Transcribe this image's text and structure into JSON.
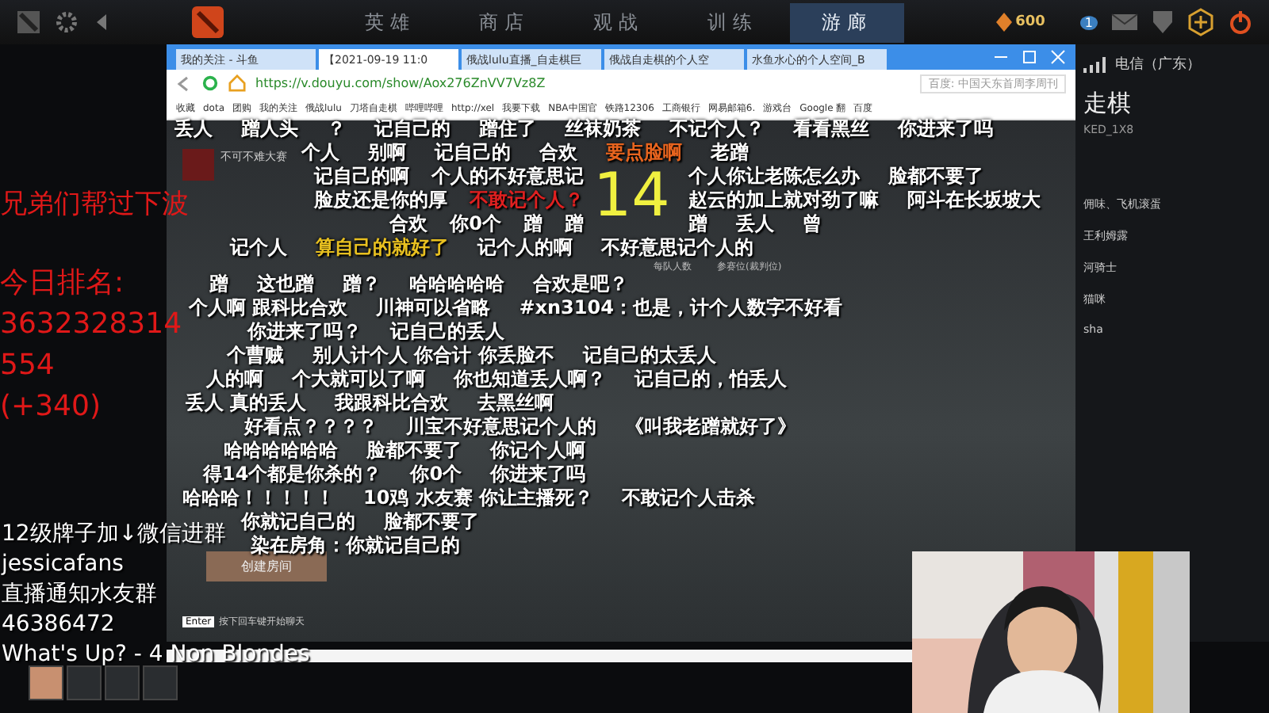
{
  "game_nav": {
    "tabs": [
      {
        "label": "英雄",
        "selected": false
      },
      {
        "label": "商店",
        "selected": false
      },
      {
        "label": "观战",
        "selected": false
      },
      {
        "label": "训练",
        "selected": false
      },
      {
        "label": "游廊",
        "selected": true
      }
    ],
    "currency": "600",
    "mail_count": "1",
    "network": "电信（广东）"
  },
  "browser": {
    "tabs": [
      {
        "title": "我的关注 - 斗鱼",
        "selected": false
      },
      {
        "title": "【2021-09-19 11:0",
        "selected": true
      },
      {
        "title": "俄战lulu直播_自走棋巨",
        "selected": false
      },
      {
        "title": "俄战自走棋的个人空",
        "selected": false
      },
      {
        "title": "水鱼水心的个人空间_B",
        "selected": false
      }
    ],
    "url": "https://v.douyu.com/show/Aox276ZnVV7Vz8Z",
    "search_placeholder": "百度: 中国天东首周李周刊",
    "bookmarks": [
      "收藏",
      "dota",
      "团购",
      "我的关注",
      "俄战lulu",
      "刀塔自走棋",
      "哔哩哔哩",
      "http://xel",
      "我要下载",
      "NBA中国官",
      "铁路12306",
      "工商银行",
      "网易邮箱6.",
      "游戏台",
      "Google 翻",
      "百度"
    ]
  },
  "stream": {
    "room_label": "不可不难大赛",
    "counter": "14",
    "table_headers": [
      "每队人数",
      "参赛位(裁判位)"
    ],
    "create_button": "创建房间",
    "enter_key": "Enter",
    "enter_hint": "按下回车键开始聊天",
    "danmaku": [
      [
        {
          "text": "丢人",
          "color": "#ffffff"
        },
        {
          "text": "蹭人头",
          "color": "#ffffff"
        },
        {
          "text": "？",
          "color": "#ffffff"
        },
        {
          "text": "记自己的",
          "color": "#ffffff"
        },
        {
          "text": "蹭住了",
          "color": "#ffffff"
        },
        {
          "text": "丝袜奶茶",
          "color": "#ffffff"
        },
        {
          "text": "不记个人？",
          "color": "#ffffff"
        },
        {
          "text": "看看黑丝",
          "color": "#ffffff"
        },
        {
          "text": "你进来了吗",
          "color": "#ffffff"
        }
      ],
      [
        {
          "text": "个人",
          "color": "#ffffff"
        },
        {
          "text": "别啊",
          "color": "#ffffff"
        },
        {
          "text": "记自己的",
          "color": "#ffffff"
        },
        {
          "text": "合欢",
          "color": "#ffffff"
        },
        {
          "text": "要点脸啊",
          "color": "#e8641e"
        },
        {
          "text": "老蹭",
          "color": "#ffffff"
        }
      ],
      [
        {
          "text": "记自己的啊",
          "color": "#ffffff"
        },
        {
          "text": "个人的不好意思记",
          "color": "#ffffff"
        },
        {
          "text": "个人你让老陈怎么办",
          "color": "#ffffff"
        },
        {
          "text": "脸都不要了",
          "color": "#ffffff"
        }
      ],
      [
        {
          "text": "脸皮还是你的厚",
          "color": "#ffffff"
        },
        {
          "text": "不敢记个人？",
          "color": "#e02020"
        },
        {
          "text": "赵云的加上就对劲了嘛",
          "color": "#ffffff"
        },
        {
          "text": "阿斗在长坂坡大",
          "color": "#ffffff"
        }
      ],
      [
        {
          "text": "合欢",
          "color": "#ffffff"
        },
        {
          "text": "你0个",
          "color": "#ffffff"
        },
        {
          "text": "蹭",
          "color": "#ffffff"
        },
        {
          "text": "蹭",
          "color": "#ffffff"
        },
        {
          "text": "蹭",
          "color": "#ffffff"
        },
        {
          "text": "丢人",
          "color": "#ffffff"
        },
        {
          "text": "曾",
          "color": "#ffffff"
        }
      ],
      [
        {
          "text": "记个人",
          "color": "#ffffff"
        },
        {
          "text": "算自己的就好了",
          "color": "#e8c020"
        },
        {
          "text": "记个人的啊",
          "color": "#ffffff"
        },
        {
          "text": "不好意思记个人的",
          "color": "#ffffff"
        }
      ],
      [
        {
          "text": "蹭",
          "color": "#ffffff"
        },
        {
          "text": "这也蹭",
          "color": "#ffffff"
        },
        {
          "text": "蹭？",
          "color": "#ffffff"
        },
        {
          "text": "哈哈哈哈哈",
          "color": "#ffffff"
        },
        {
          "text": "合欢是吧？",
          "color": "#ffffff"
        }
      ],
      [
        {
          "text": "个人啊 跟科比合欢",
          "color": "#ffffff"
        },
        {
          "text": "川神可以省略",
          "color": "#ffffff"
        },
        {
          "text": "#xn3104：也是，计个人数字不好看",
          "color": "#ffffff"
        }
      ],
      [
        {
          "text": "你进来了吗？",
          "color": "#ffffff"
        },
        {
          "text": "记自己的丢人",
          "color": "#ffffff"
        }
      ],
      [
        {
          "text": "个曹贼",
          "color": "#ffffff"
        },
        {
          "text": "别人计个人 你合计 你丢脸不",
          "color": "#ffffff"
        },
        {
          "text": "记自己的太丢人",
          "color": "#ffffff"
        }
      ],
      [
        {
          "text": "人的啊",
          "color": "#ffffff"
        },
        {
          "text": "个大就可以了啊",
          "color": "#ffffff"
        },
        {
          "text": "你也知道丢人啊？",
          "color": "#ffffff"
        },
        {
          "text": "记自己的，怕丢人",
          "color": "#ffffff"
        }
      ],
      [
        {
          "text": "丢人 真的丢人",
          "color": "#ffffff"
        },
        {
          "text": "我跟科比合欢",
          "color": "#ffffff"
        },
        {
          "text": "去黑丝啊",
          "color": "#ffffff"
        }
      ],
      [
        {
          "text": "好看点？？？？",
          "color": "#ffffff"
        },
        {
          "text": "川宝不好意思记个人的",
          "color": "#ffffff"
        },
        {
          "text": "《叫我老蹭就好了》",
          "color": "#ffffff"
        }
      ],
      [
        {
          "text": "哈哈哈哈哈哈",
          "color": "#ffffff"
        },
        {
          "text": "脸都不要了",
          "color": "#ffffff"
        },
        {
          "text": "你记个人啊",
          "color": "#ffffff"
        }
      ],
      [
        {
          "text": "得14个都是你杀的？",
          "color": "#ffffff"
        },
        {
          "text": "你0个",
          "color": "#ffffff"
        },
        {
          "text": "你进来了吗",
          "color": "#ffffff"
        }
      ],
      [
        {
          "text": "哈哈哈！！！！！",
          "color": "#ffffff"
        },
        {
          "text": "10鸡 水友赛 你让主播死？",
          "color": "#ffffff"
        },
        {
          "text": "不敢记个人击杀",
          "color": "#ffffff"
        }
      ],
      [
        {
          "text": "你就记自己的",
          "color": "#ffffff"
        },
        {
          "text": "脸都不要了",
          "color": "#ffffff"
        }
      ],
      [
        {
          "text": "染在房角：你就记自己的",
          "color": "#ffffff"
        }
      ]
    ]
  },
  "side_panel": {
    "title": "走棋",
    "subtitle": "KED_1X8",
    "items": [
      "佣味、飞机滚蛋",
      "王利姆露",
      "河骑士",
      "猫咪",
      "sha"
    ]
  },
  "overlay": {
    "notice": "兄弟们帮过下波",
    "rank_label": "今日排名:",
    "rank_lines": [
      "3632328314",
      "554",
      "(+340)"
    ],
    "info_lines": [
      "12级牌子加↓微信进群",
      "jessicafans",
      "直播通知水友群",
      "46386472"
    ],
    "now_playing": "What's Up? - 4 Non Blondes"
  }
}
